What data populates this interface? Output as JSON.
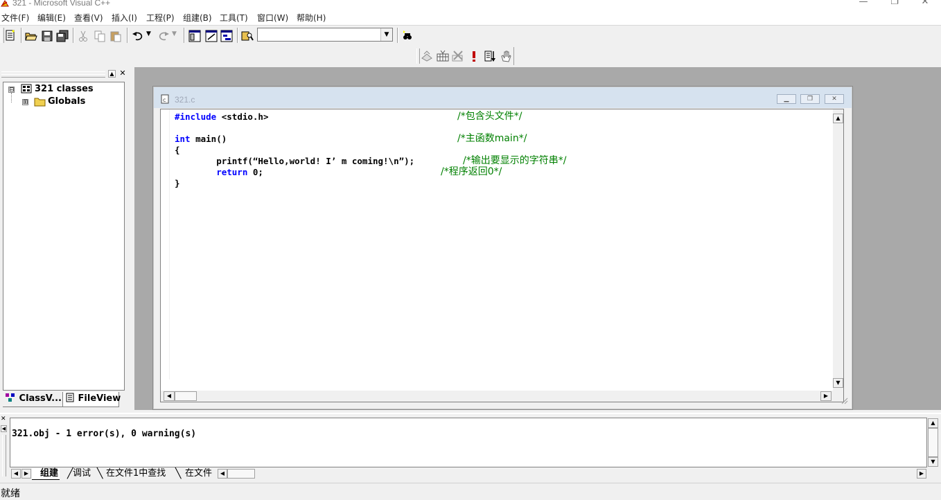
{
  "window": {
    "title": "321 - Microsoft Visual C++",
    "minimize": "—",
    "restore": "❐",
    "close": "✕"
  },
  "menu": [
    "文件(F)",
    "编辑(E)",
    "查看(V)",
    "插入(I)",
    "工程(P)",
    "组建(B)",
    "工具(T)",
    "窗口(W)",
    "帮助(H)"
  ],
  "toolbar": {
    "icons": [
      "new-text-file-icon",
      "open-folder-icon",
      "save-icon",
      "save-all-icon",
      "cut-icon",
      "copy-icon",
      "paste-icon",
      "undo-icon",
      "redo-icon",
      "workspace-icon",
      "output-window-icon",
      "window-list-icon",
      "find-in-files-icon",
      "find-icon"
    ],
    "find_combo_value": "",
    "build_icons": [
      "compile-icon",
      "build-icon",
      "stop-build-icon",
      "execute-icon",
      "go-icon",
      "insert-breakpoint-icon"
    ]
  },
  "workspace": {
    "tree": [
      {
        "label": "321 classes",
        "expander": "⊟"
      },
      {
        "label": "Globals",
        "expander": "⊞"
      }
    ],
    "tabs": [
      "ClassV...",
      "FileView"
    ]
  },
  "document": {
    "title": "321.c",
    "code": [
      {
        "kw": "#include",
        "text": " <stdio.h>",
        "comment": "/*包含头文件*/"
      },
      {
        "kw": "",
        "text": "",
        "comment": ""
      },
      {
        "kw": "int",
        "text": " main()",
        "comment": "/*主函数main*/"
      },
      {
        "kw": "",
        "text": "{",
        "comment": ""
      },
      {
        "kw": "",
        "text": "        printf(“Hello,world! I’ m coming!\\n”);",
        "comment": "/*输出要显示的字符串*/"
      },
      {
        "kw": "        return",
        "text": " 0;",
        "comment": "/*程序返回0*/"
      },
      {
        "kw": "",
        "text": "}",
        "comment": ""
      }
    ]
  },
  "output": {
    "text": "321.obj - 1 error(s), 0 warning(s)",
    "tabs": [
      "组建",
      "调试",
      "在文件1中查找",
      "在文件"
    ]
  },
  "status": {
    "text": "就绪"
  },
  "colors": {
    "keyword": "#0000ff",
    "comment": "#008000",
    "mdi_background": "#a9a9a9",
    "doc_titlebar": "#d6e2ef"
  }
}
